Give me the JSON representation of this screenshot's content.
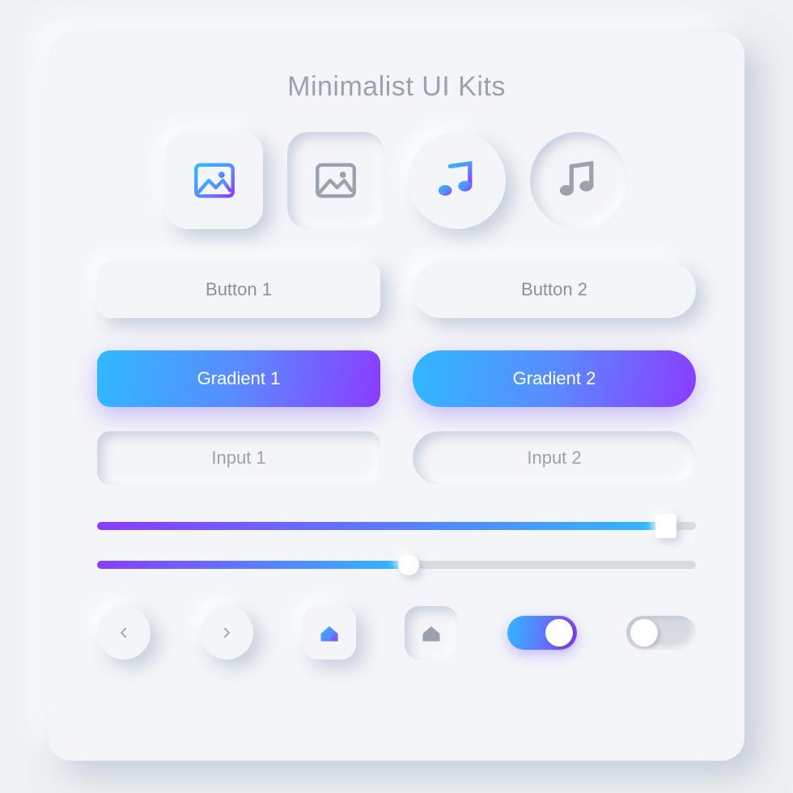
{
  "title": "Minimalist UI Kits",
  "colors": {
    "gradient_start": "#2fb9ff",
    "gradient_mid": "#5a8bff",
    "gradient_end": "#8a3cff",
    "slider_start": "#8a3cff",
    "slider_end": "#2fb9ff",
    "icon_muted": "#9aa2ad"
  },
  "icon_buttons": [
    {
      "name": "image-icon",
      "shape": "square",
      "style": "raised",
      "variant": "gradient"
    },
    {
      "name": "image-icon",
      "shape": "square",
      "style": "inset",
      "variant": "muted"
    },
    {
      "name": "music-icon",
      "shape": "circle",
      "style": "raised",
      "variant": "gradient"
    },
    {
      "name": "music-icon",
      "shape": "circle",
      "style": "inset",
      "variant": "muted"
    }
  ],
  "buttons": {
    "plain": [
      {
        "label": "Button 1",
        "shape": "rounded"
      },
      {
        "label": "Button 2",
        "shape": "pill"
      }
    ],
    "gradient": [
      {
        "label": "Gradient 1",
        "shape": "rounded"
      },
      {
        "label": "Gradient 2",
        "shape": "pill"
      }
    ]
  },
  "inputs": [
    {
      "placeholder": "Input 1",
      "shape": "rounded"
    },
    {
      "placeholder": "Input 2",
      "shape": "pill"
    }
  ],
  "sliders": [
    {
      "value": 95,
      "thumb": "square"
    },
    {
      "value": 52,
      "thumb": "round"
    }
  ],
  "nav": {
    "prev": "chevron-left-icon",
    "next": "chevron-right-icon",
    "home_active": "home-icon",
    "home_inactive": "home-icon"
  },
  "toggles": [
    {
      "state": "on"
    },
    {
      "state": "off"
    }
  ]
}
